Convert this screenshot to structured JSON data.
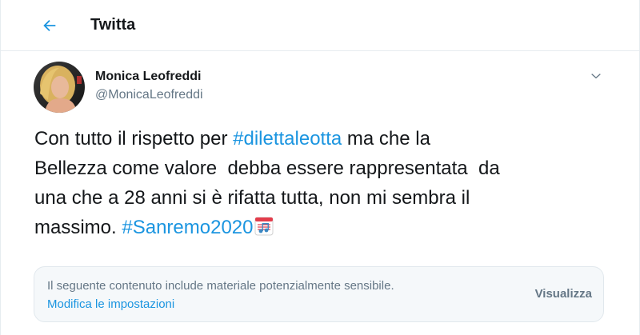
{
  "header": {
    "title": "Twitta",
    "back_icon": "arrow-left-icon",
    "accent_color": "#1b95e0"
  },
  "tweet": {
    "author": {
      "name": "Monica Leofreddi",
      "handle": "@MonicaLeofreddi"
    },
    "menu_icon": "chevron-down-icon",
    "text": {
      "part1": "Con tutto il rispetto per ",
      "hashtag1": "#dilettaleotta",
      "part2": " ma che la\nBellezza come valore  debba essere rappresentata  da\nuna che a 28 anni si è rifatta tutta, non mi sembra il\nmassimo. ",
      "hashtag2": "#Sanremo2020",
      "emoji": "musical-score-emoji"
    },
    "sensitive": {
      "notice": "Il seguente contenuto include materiale potenzialmente sensibile.",
      "settings_link": "Modifica le impostazioni",
      "view_button": "Visualizza"
    }
  }
}
